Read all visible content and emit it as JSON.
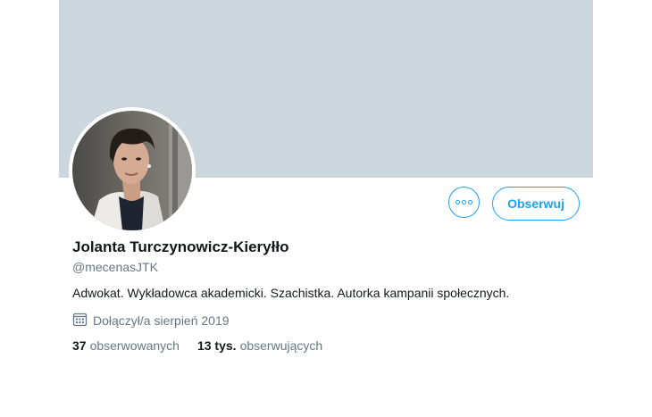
{
  "profile": {
    "name": "Jolanta Turczynowicz-Kieryłło",
    "handle": "@mecenasJTK",
    "bio": "Adwokat. Wykładowca akademicki. Szachistka. Autorka kampanii społecznych.",
    "joined": "Dołączył/a sierpień 2019"
  },
  "actions": {
    "follow_label": "Obserwuj",
    "more_icon": "more-icon"
  },
  "stats": [
    {
      "value": "37",
      "label": "obserwowanych"
    },
    {
      "value": "13 tys.",
      "label": "obserwujących"
    }
  ],
  "colors": {
    "accent": "#1da1f2",
    "banner": "#ccd6dd",
    "text": "#14171a",
    "secondary": "#657786"
  }
}
